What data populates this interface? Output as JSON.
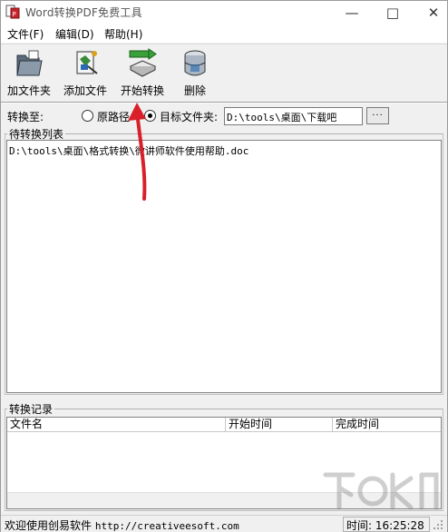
{
  "window": {
    "title": "Word转换PDF免费工具",
    "minimize_glyph": "—",
    "restore_glyph": "□",
    "close_glyph": "✕"
  },
  "menu": {
    "items": [
      {
        "label": "文件(F)"
      },
      {
        "label": "编辑(D)"
      },
      {
        "label": "帮助(H)"
      }
    ]
  },
  "toolbar": {
    "buttons": [
      {
        "label": "加文件夹",
        "icon": "folder-icon"
      },
      {
        "label": "添加文件",
        "icon": "add-file-icon"
      },
      {
        "label": "开始转换",
        "icon": "convert-icon"
      },
      {
        "label": "删除",
        "icon": "delete-icon"
      }
    ]
  },
  "destination": {
    "label": "转换至:",
    "option_original": "原路径",
    "option_target": "目标文件夹:",
    "selected": "target",
    "path_value": "D:\\tools\\桌面\\下载吧",
    "browse_label": "···"
  },
  "pending": {
    "title": "待转换列表",
    "items": [
      "D:\\tools\\桌面\\格式转换\\微讲师软件使用帮助.doc"
    ]
  },
  "history": {
    "title": "转换记录",
    "columns": [
      "文件名",
      "开始时间",
      "完成时间"
    ]
  },
  "status": {
    "welcome": "欢迎使用创易软件",
    "url": "http://creativeesoft.com",
    "time_label": "时间:",
    "time_value": "16:25:28"
  },
  "colors": {
    "window_bg": "#f0f0f0",
    "annotation_arrow": "#d9202a"
  }
}
